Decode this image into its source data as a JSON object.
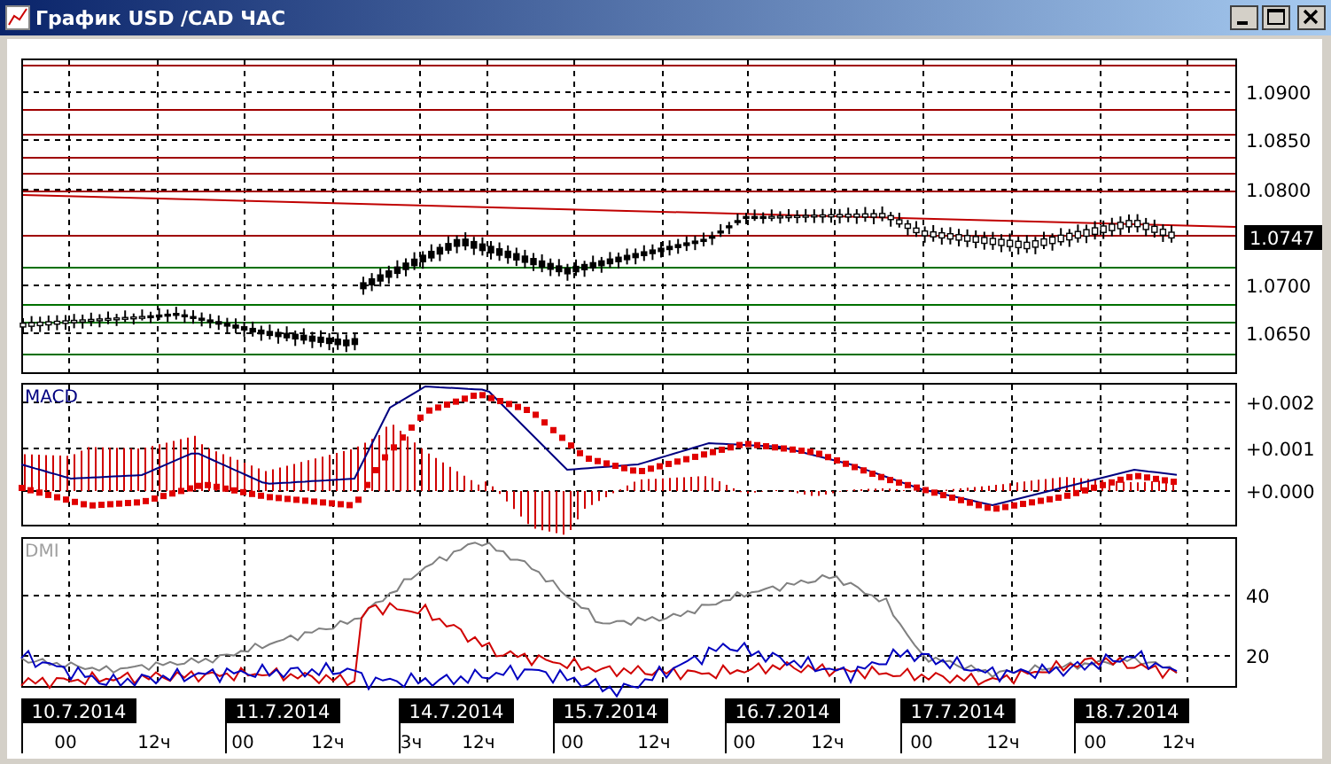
{
  "window": {
    "title": "График USD /CAD  ЧАС"
  },
  "price_panel": {
    "axis_labels": [
      "1.0900",
      "1.0850",
      "1.0800",
      "1.0700",
      "1.0650"
    ],
    "current_price": "1.0747"
  },
  "macd_panel": {
    "label": "MACD",
    "axis_labels": [
      "+0.002",
      "+0.001",
      "+0.000"
    ]
  },
  "dmi_panel": {
    "label": "DMI",
    "axis_labels": [
      "40",
      "20"
    ]
  },
  "time_axis": [
    {
      "date": "10.7.2014",
      "hours": [
        "00",
        "12ч"
      ]
    },
    {
      "date": "11.7.2014",
      "hours": [
        "00",
        "12ч"
      ]
    },
    {
      "date": "14.7.2014",
      "hours": [
        "3ч",
        "12ч"
      ]
    },
    {
      "date": "15.7.2014",
      "hours": [
        "00",
        "12ч"
      ]
    },
    {
      "date": "16.7.2014",
      "hours": [
        "00",
        "12ч"
      ]
    },
    {
      "date": "17.7.2014",
      "hours": [
        "00",
        "12ч"
      ]
    },
    {
      "date": "18.7.2014",
      "hours": [
        "00",
        "12ч"
      ]
    }
  ]
}
